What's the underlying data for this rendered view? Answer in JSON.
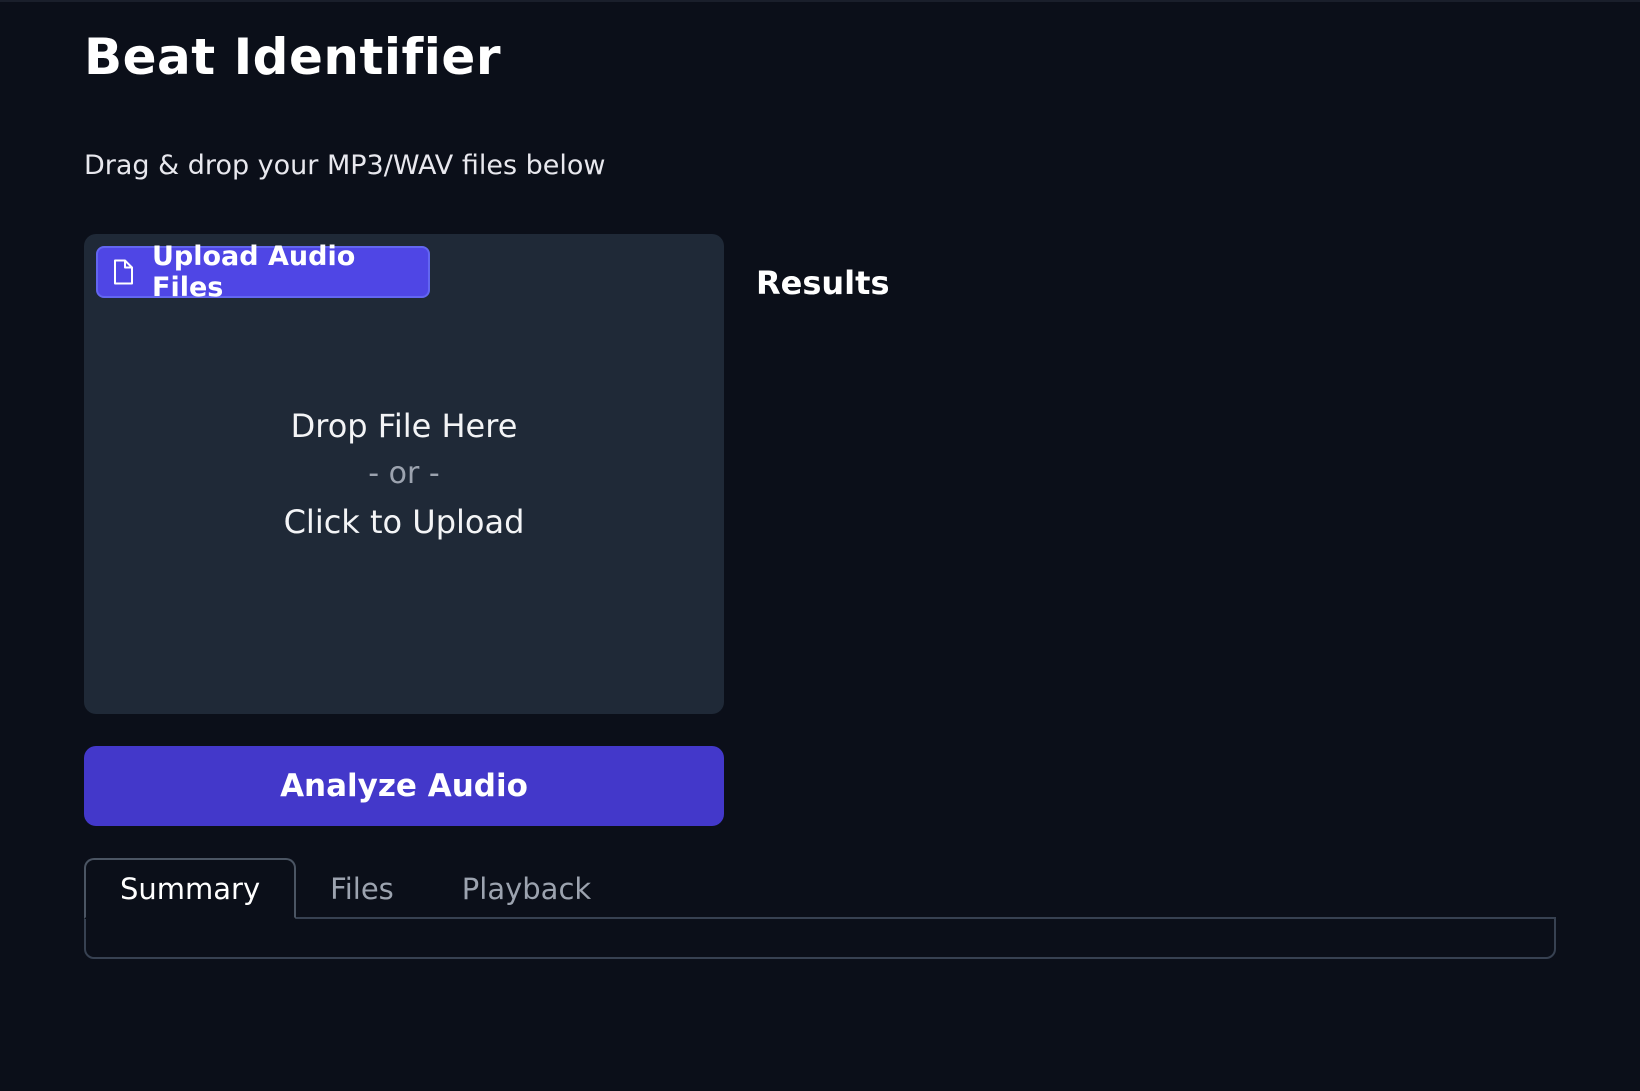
{
  "app": {
    "title": "Beat Identifier",
    "subtitle": "Drag & drop your MP3/WAV files below"
  },
  "upload": {
    "label": "Upload Audio Files",
    "icon": "file-icon",
    "drop_line1": "Drop File Here",
    "drop_line2": "- or -",
    "drop_line3": "Click to Upload"
  },
  "results": {
    "heading": "Results"
  },
  "actions": {
    "analyze_label": "Analyze Audio"
  },
  "tabs": [
    {
      "label": "Summary",
      "active": true
    },
    {
      "label": "Files",
      "active": false
    },
    {
      "label": "Playback",
      "active": false
    }
  ],
  "colors": {
    "background": "#0b0f19",
    "panel": "#1f2937",
    "accent": "#4f46e5",
    "button": "#4338ca"
  }
}
